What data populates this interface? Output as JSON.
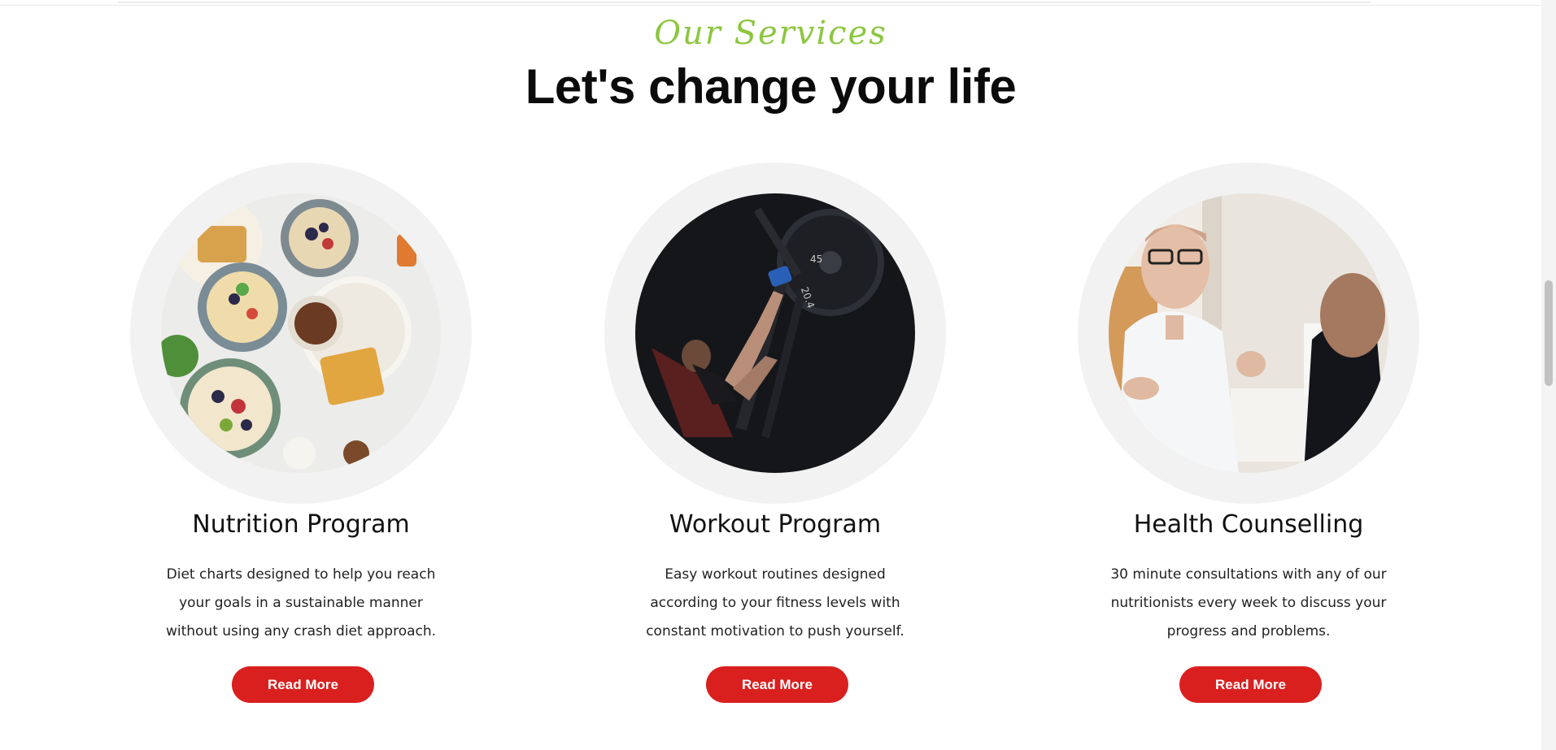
{
  "section": {
    "kicker": "Our Services",
    "headline": "Let's change your life"
  },
  "services": [
    {
      "title": "Nutrition Program",
      "description": "Diet charts designed to help you reach your goals in a sustainable manner without using any crash diet approach.",
      "button_label": "Read More",
      "image": "healthy-breakfast-bowls-photo"
    },
    {
      "title": "Workout Program",
      "description": "Easy workout routines designed according to your fitness levels with constant motivation to push yourself.",
      "button_label": "Read More",
      "image": "leg-press-workout-photo"
    },
    {
      "title": "Health Counselling",
      "description": "30 minute consultations with any of our nutritionists every week to discuss your progress and problems.",
      "button_label": "Read More",
      "image": "doctor-consultation-photo"
    }
  ],
  "colors": {
    "accent_green": "#8cc63f",
    "button_red": "#d9201f",
    "ring_gray": "#f2f2f2"
  }
}
